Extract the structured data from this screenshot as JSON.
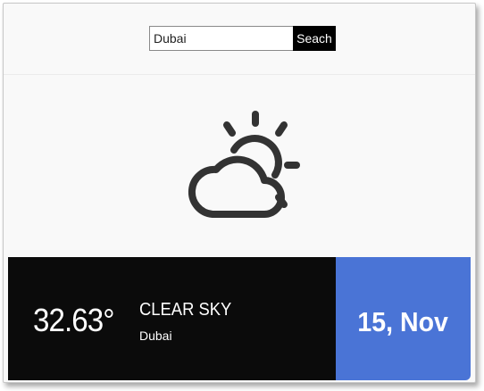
{
  "search": {
    "value": "Dubai",
    "button_label": "Seach"
  },
  "weather": {
    "icon": "partly-cloudy-icon",
    "temperature": "32.63°",
    "condition": "CLEAR SKY",
    "city": "Dubai",
    "date": "15, Nov"
  },
  "colors": {
    "panel_dark": "#0b0b0b",
    "date_accent": "#4a74d6",
    "icon_stroke": "#333333"
  }
}
